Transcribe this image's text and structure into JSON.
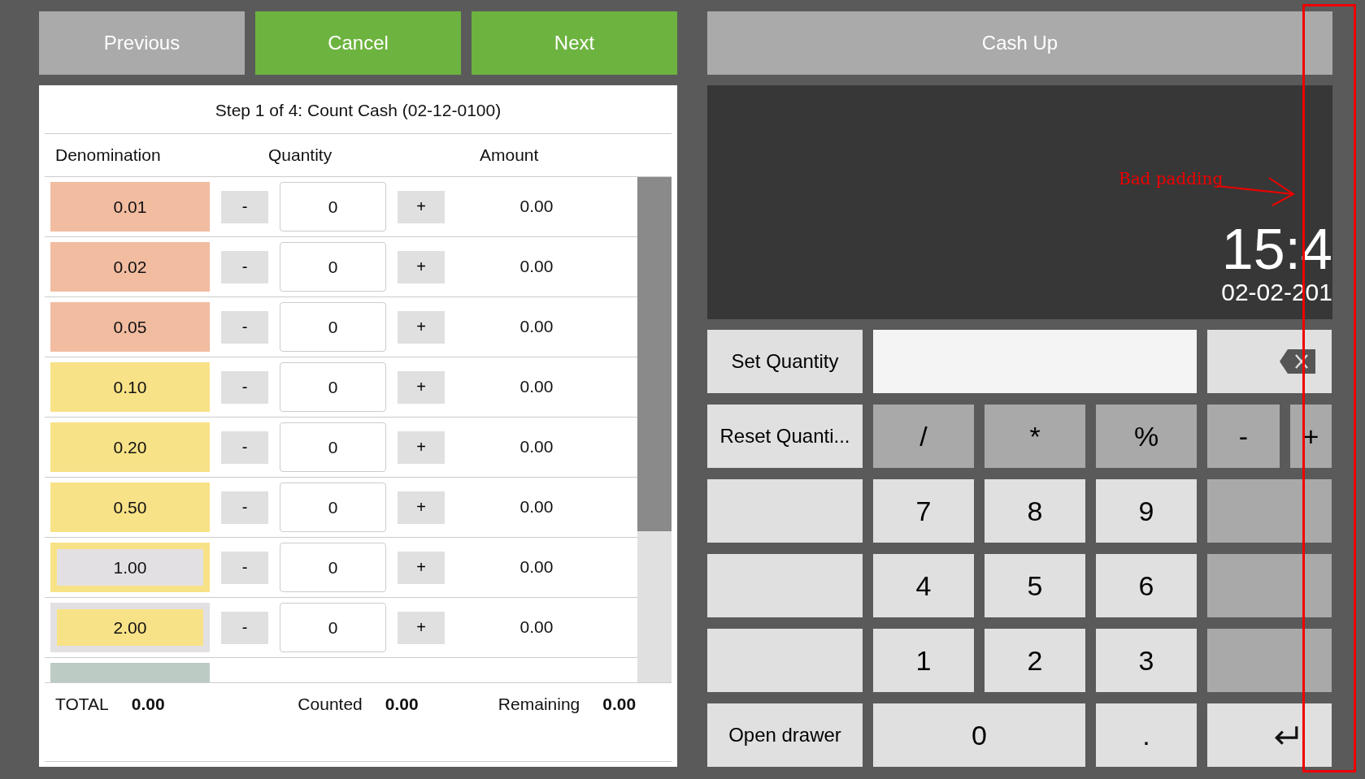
{
  "nav_buttons": [
    {
      "label": "Previous",
      "kind": "muted"
    },
    {
      "label": "Cancel",
      "kind": "primary"
    },
    {
      "label": "Next",
      "kind": "primary"
    }
  ],
  "step_title": "Step 1 of 4: Count Cash (02-12-0100)",
  "columns": [
    "Denomination",
    "Quantity",
    "Amount"
  ],
  "rows": [
    {
      "denomination": "0.01",
      "color": "#f2bca0",
      "quantity": "0",
      "amount": "0.00",
      "minus": "-",
      "plus": "+"
    },
    {
      "denomination": "0.02",
      "color": "#f2bca0",
      "quantity": "0",
      "amount": "0.00",
      "minus": "-",
      "plus": "+"
    },
    {
      "denomination": "0.05",
      "color": "#f2bca0",
      "quantity": "0",
      "amount": "0.00",
      "minus": "-",
      "plus": "+"
    },
    {
      "denomination": "0.10",
      "color": "#f8e287",
      "quantity": "0",
      "amount": "0.00",
      "minus": "-",
      "plus": "+"
    },
    {
      "denomination": "0.20",
      "color": "#f8e287",
      "quantity": "0",
      "amount": "0.00",
      "minus": "-",
      "plus": "+"
    },
    {
      "denomination": "0.50",
      "color": "#f8e287",
      "quantity": "0",
      "amount": "0.00",
      "minus": "-",
      "plus": "+"
    },
    {
      "denomination": "1.00",
      "color": "#e3e0e3",
      "frame": {
        "color": "#f8e287"
      },
      "quantity": "0",
      "amount": "0.00",
      "minus": "-",
      "plus": "+"
    },
    {
      "denomination": "2.00",
      "color": "#f8e287",
      "frame": {
        "color": "#e3e0e3"
      },
      "quantity": "0",
      "amount": "0.00",
      "minus": "-",
      "plus": "+"
    },
    {
      "color": "#bccbc4"
    }
  ],
  "totals": [
    {
      "label": "TOTAL",
      "value": "0.00"
    },
    {
      "label": "Counted",
      "value": "0.00"
    },
    {
      "label": "Remaining",
      "value": "0.00"
    }
  ],
  "cash_up_title": "Cash Up",
  "display": {
    "time": "15:4",
    "date": "02-02-201"
  },
  "keypad": [
    {
      "kind": "action",
      "label": "Set Quantity"
    },
    {
      "kind": "field"
    },
    {
      "kind": "backspace"
    },
    {
      "kind": "action",
      "label": "Reset Quanti..."
    },
    {
      "kind": "operator",
      "label": "/"
    },
    {
      "kind": "operator",
      "label": "*"
    },
    {
      "kind": "operator",
      "label": "%"
    },
    {
      "kind": "operator",
      "label": "-"
    },
    {
      "kind": "operator",
      "label": "+"
    },
    {
      "kind": "action"
    },
    {
      "kind": "digit",
      "label": "7"
    },
    {
      "kind": "digit",
      "label": "8"
    },
    {
      "kind": "digit",
      "label": "9"
    },
    {
      "kind": "filler"
    },
    {
      "kind": "action"
    },
    {
      "kind": "digit",
      "label": "4"
    },
    {
      "kind": "digit",
      "label": "5"
    },
    {
      "kind": "digit",
      "label": "6"
    },
    {
      "kind": "filler"
    },
    {
      "kind": "action"
    },
    {
      "kind": "digit",
      "label": "1"
    },
    {
      "kind": "digit",
      "label": "2"
    },
    {
      "kind": "digit",
      "label": "3"
    },
    {
      "kind": "filler"
    },
    {
      "kind": "action",
      "label": "Open drawer"
    },
    {
      "kind": "digit-wide",
      "label": "0"
    },
    {
      "kind": "digit",
      "label": "."
    },
    {
      "kind": "enter"
    }
  ],
  "annotation": {
    "text": "Bad padding"
  }
}
